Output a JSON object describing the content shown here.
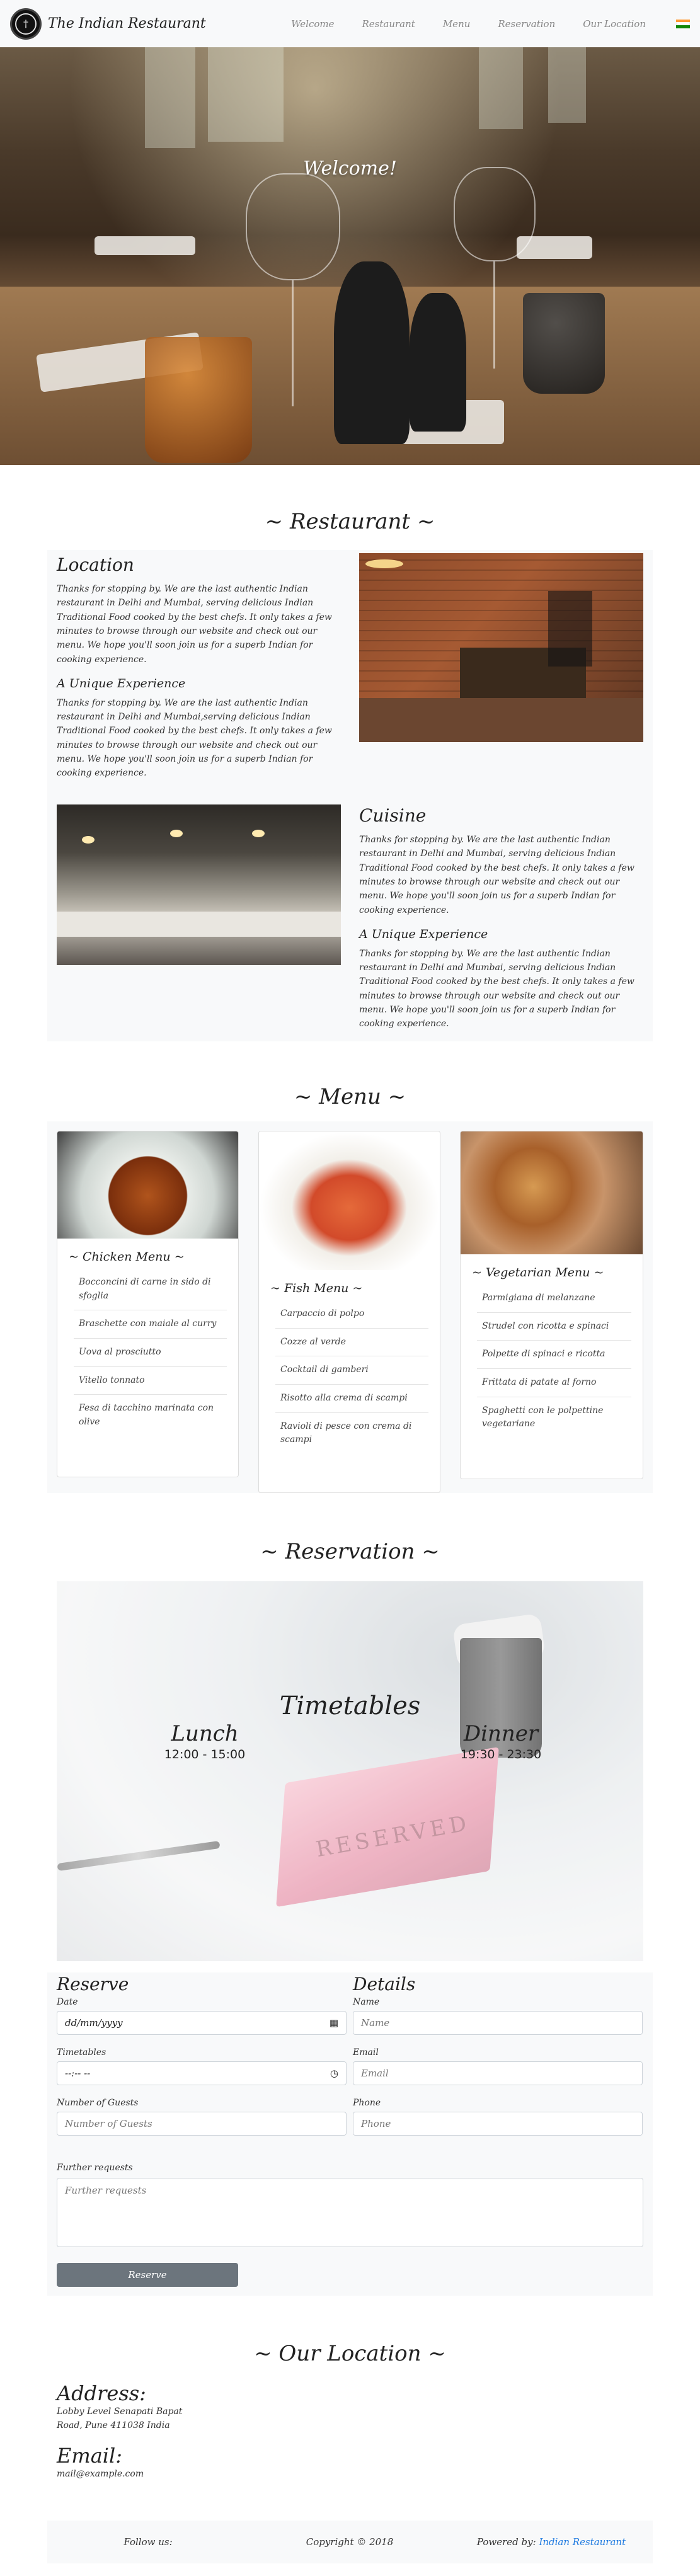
{
  "navbar": {
    "brand": "The Indian Restaurant",
    "links": [
      "Welcome",
      "Restaurant",
      "Menu",
      "Reservation",
      "Our Location"
    ],
    "flag_colors": [
      "#ff9933",
      "#ffffff",
      "#138808"
    ]
  },
  "hero": {
    "title": "Welcome!"
  },
  "restaurant": {
    "heading": "~ Restaurant ~",
    "location": {
      "title": "Location",
      "text": "Thanks for stopping by. We are the last authentic Indian restaurant in Delhi and Mumbai, serving delicious Indian Traditional Food cooked by the best chefs. It only takes a few minutes to browse through our website and check out our menu. We hope you'll soon join us for a superb Indian for cooking experience.",
      "sub_title": "A Unique Experience",
      "sub_text": "Thanks for stopping by. We are the last authentic Indian restaurant in Delhi and Mumbai,serving delicious Indian Traditional Food cooked by the best chefs. It only takes a few minutes to browse through our website and check out our menu. We hope you'll soon join us for a superb Indian for cooking experience."
    },
    "cuisine": {
      "title": "Cuisine",
      "text": "Thanks for stopping by. We are the last authentic Indian restaurant in Delhi and Mumbai, serving delicious Indian Traditional Food cooked by the best chefs. It only takes a few minutes to browse through our website and check out our menu. We hope you'll soon join us for a superb Indian for cooking experience.",
      "sub_title": "A Unique Experience",
      "sub_text": "Thanks for stopping by. We are the last authentic Indian restaurant in Delhi and Mumbai, serving delicious Indian Traditional Food cooked by the best chefs. It only takes a few minutes to browse through our website and check out our menu. We hope you'll soon join us for a superb Indian for cooking experience."
    }
  },
  "menu": {
    "heading": "~ Menu ~",
    "cards": [
      {
        "title": "~ Chicken Menu ~",
        "items": [
          "Bocconcini di carne in sido di sfoglia",
          "Braschette con maiale al curry",
          "Uova al prosciutto",
          "Vitello tonnato",
          "Fesa di tacchino marinata con olive"
        ]
      },
      {
        "title": "~ Fish Menu ~",
        "items": [
          "Carpaccio di polpo",
          "Cozze al verde",
          "Cocktail di gamberi",
          "Risotto alla crema di scampi",
          "Ravioli di pesce con crema di scampi"
        ]
      },
      {
        "title": "~ Vegetarian Menu ~",
        "items": [
          "Parmigiana di melanzane",
          "Strudel con ricotta e spinaci",
          "Polpette di spinaci e ricotta",
          "Frittata di patate al forno",
          "Spaghetti con le polpettine vegetariane"
        ]
      }
    ]
  },
  "reservation": {
    "heading": "~ Reservation ~",
    "timetables_title": "Timetables",
    "lunch": {
      "label": "Lunch",
      "hours": "12:00 - 15:00"
    },
    "dinner": {
      "label": "Dinner",
      "hours": "19:30 - 23:30"
    },
    "sign_text": "RESERVED",
    "form": {
      "reserve_title": "Reserve",
      "details_title": "Details",
      "date_label": "Date",
      "date_value": "dd/mm/yyyy",
      "time_label": "Timetables",
      "time_value": "--:-- --",
      "guests_label": "Number of Guests",
      "guests_placeholder": "Number of Guests",
      "name_label": "Name",
      "name_placeholder": "Name",
      "email_label": "Email",
      "email_placeholder": "Email",
      "phone_label": "Phone",
      "phone_placeholder": "Phone",
      "requests_label": "Further requests",
      "requests_placeholder": "Further requests",
      "submit_label": "Reserve"
    }
  },
  "location": {
    "heading": "~ Our Location ~",
    "address_title": "Address:",
    "address_line1": "Lobby Level Senapati Bapat",
    "address_line2": "Road, Pune 411038 India",
    "email_title": "Email:",
    "email_value": "mail@example.com"
  },
  "footer": {
    "follow": "Follow us:",
    "copyright": "Copyright © 2018",
    "powered_prefix": "Powered by:",
    "powered_link": "Indian Restaurant"
  }
}
